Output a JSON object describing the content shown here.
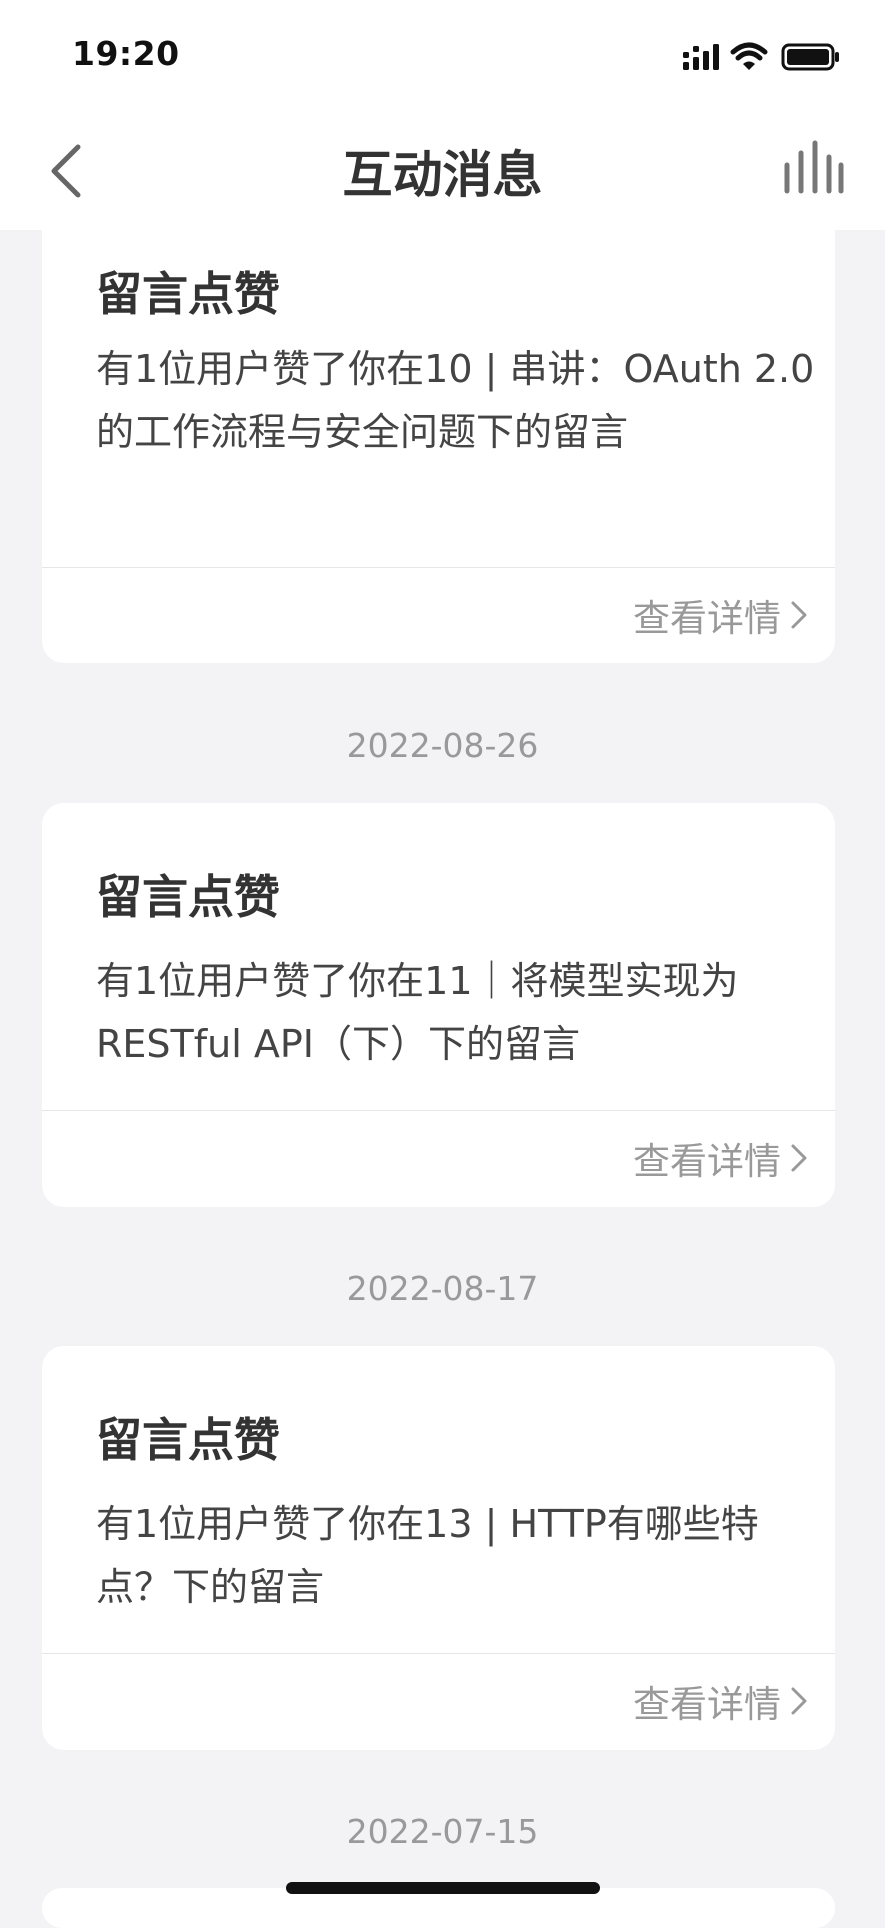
{
  "status_bar": {
    "time": "19:20"
  },
  "header": {
    "title": "互动消息"
  },
  "detail_label": "查看详情",
  "cards": [
    {
      "title": "留言点赞",
      "body": "有1位用户赞了你在10 | 串讲：OAuth 2.0的工作流程与安全问题下的留言"
    },
    {
      "date": "2022-08-26",
      "title": "留言点赞",
      "body": "有1位用户赞了你在11｜将模型实现为RESTful API（下）下的留言"
    },
    {
      "date": "2022-08-17",
      "title": "留言点赞",
      "body": "有1位用户赞了你在13 | HTTP有哪些特点？下的留言"
    },
    {
      "date": "2022-07-15"
    }
  ]
}
